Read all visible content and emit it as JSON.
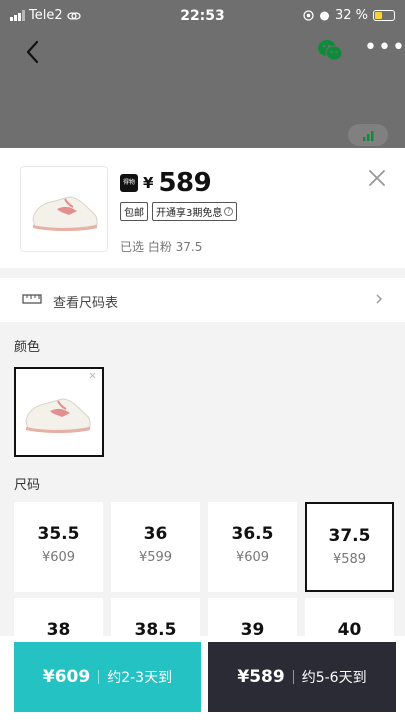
{
  "status_bar": {
    "carrier": "Tele2",
    "time": "22:53",
    "battery": "32 %"
  },
  "nav": {
    "back_icon": "chevron-left-icon",
    "share_icon": "wechat-icon",
    "more_icon": "more-icon"
  },
  "product": {
    "currency": "¥",
    "price": "589",
    "tags": [
      "包邮",
      "开通享3期免息"
    ],
    "selected": "已选 白粉 37.5"
  },
  "size_chart": {
    "label": "查看尺码表"
  },
  "color_section": {
    "title": "颜色"
  },
  "size_section": {
    "title": "尺码",
    "sizes": [
      {
        "size": "35.5",
        "price": "¥609"
      },
      {
        "size": "36",
        "price": "¥599"
      },
      {
        "size": "36.5",
        "price": "¥609"
      },
      {
        "size": "37.5",
        "price": "¥589"
      },
      {
        "size": "38",
        "price": ""
      },
      {
        "size": "38.5",
        "price": ""
      },
      {
        "size": "39",
        "price": ""
      },
      {
        "size": "40",
        "price": ""
      }
    ],
    "selected_index": 3
  },
  "actions": {
    "fast": {
      "price": "¥609",
      "eta": "约2-3天到"
    },
    "standard": {
      "price": "¥589",
      "eta": "约5-6天到"
    }
  },
  "colors": {
    "teal": "#25c2c3",
    "dark": "#2b2b35",
    "shoe_pink": "#e48f8f"
  }
}
